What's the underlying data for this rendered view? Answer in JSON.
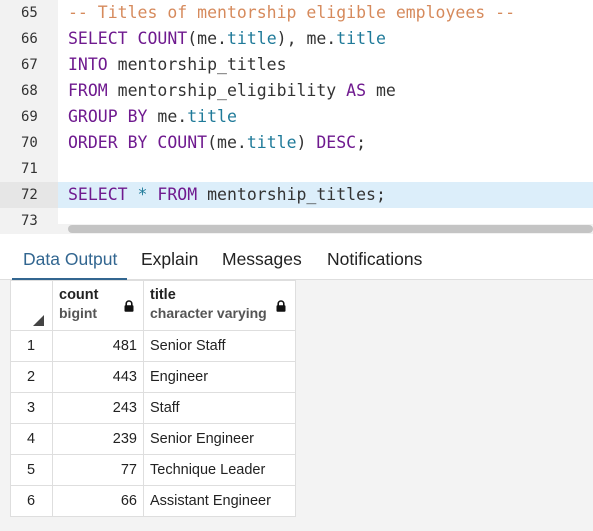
{
  "editor": {
    "lines": [
      {
        "num": "65",
        "highlight": false,
        "tokens": [
          {
            "t": "cmt",
            "v": "-- Titles of mentorship eligible employees --"
          }
        ]
      },
      {
        "num": "66",
        "highlight": false,
        "tokens": [
          {
            "t": "kw",
            "v": "SELECT "
          },
          {
            "t": "fn",
            "v": "COUNT"
          },
          {
            "t": "plain",
            "v": "(me."
          },
          {
            "t": "id",
            "v": "title"
          },
          {
            "t": "plain",
            "v": "), me."
          },
          {
            "t": "id",
            "v": "title"
          }
        ]
      },
      {
        "num": "67",
        "highlight": false,
        "tokens": [
          {
            "t": "kw",
            "v": "INTO "
          },
          {
            "t": "plain",
            "v": "mentorship_titles"
          }
        ]
      },
      {
        "num": "68",
        "highlight": false,
        "tokens": [
          {
            "t": "kw",
            "v": "FROM "
          },
          {
            "t": "plain",
            "v": "mentorship_eligibility "
          },
          {
            "t": "kw",
            "v": "AS "
          },
          {
            "t": "plain",
            "v": "me"
          }
        ]
      },
      {
        "num": "69",
        "highlight": false,
        "tokens": [
          {
            "t": "kw",
            "v": "GROUP BY "
          },
          {
            "t": "plain",
            "v": "me."
          },
          {
            "t": "id",
            "v": "title"
          }
        ]
      },
      {
        "num": "70",
        "highlight": false,
        "tokens": [
          {
            "t": "kw",
            "v": "ORDER BY "
          },
          {
            "t": "fn",
            "v": "COUNT"
          },
          {
            "t": "plain",
            "v": "(me."
          },
          {
            "t": "id",
            "v": "title"
          },
          {
            "t": "plain",
            "v": ") "
          },
          {
            "t": "kw",
            "v": "DESC"
          },
          {
            "t": "plain",
            "v": ";"
          }
        ]
      },
      {
        "num": "71",
        "highlight": false,
        "tokens": []
      },
      {
        "num": "72",
        "highlight": true,
        "tokens": [
          {
            "t": "kw",
            "v": "SELECT "
          },
          {
            "t": "op",
            "v": "* "
          },
          {
            "t": "kw",
            "v": "FROM "
          },
          {
            "t": "plain",
            "v": "mentorship_titles;"
          }
        ]
      },
      {
        "num": "73",
        "highlight": false,
        "tokens": []
      }
    ]
  },
  "results": {
    "tabs": [
      {
        "label": "Data Output",
        "active": true
      },
      {
        "label": "Explain",
        "active": false
      },
      {
        "label": "Messages",
        "active": false
      },
      {
        "label": "Notifications",
        "active": false
      }
    ],
    "columns": [
      {
        "name": "count",
        "type": "bigint",
        "lock_icon": "lock-icon"
      },
      {
        "name": "title",
        "type": "character varying",
        "lock_icon": "lock-icon"
      }
    ],
    "rows": [
      {
        "num": "1",
        "count": "481",
        "title": "Senior Staff"
      },
      {
        "num": "2",
        "count": "443",
        "title": "Engineer"
      },
      {
        "num": "3",
        "count": "243",
        "title": "Staff"
      },
      {
        "num": "4",
        "count": "239",
        "title": "Senior Engineer"
      },
      {
        "num": "5",
        "count": "77",
        "title": "Technique Leader"
      },
      {
        "num": "6",
        "count": "66",
        "title": "Assistant Engineer"
      }
    ]
  }
}
